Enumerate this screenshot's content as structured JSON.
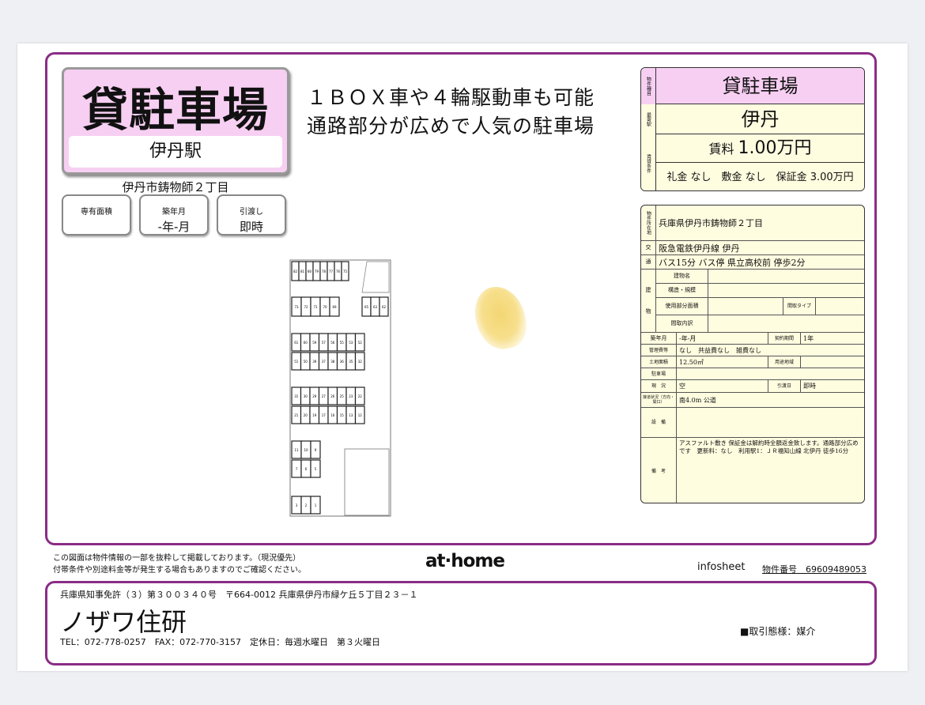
{
  "header": {
    "property_type": "貸駐車場",
    "station": "伊丹駅",
    "address_short": "伊丹市鋳物師２丁目",
    "catchcopy_line1": "１ＢＯＸ車や４輪駆動車も可能",
    "catchcopy_line2": "通路部分が広めで人気の駐車場"
  },
  "pills": [
    {
      "label": "専有面積",
      "value": ""
    },
    {
      "label": "築年月",
      "value": "-年-月"
    },
    {
      "label": "引渡し",
      "value": "即時"
    }
  ],
  "summary": {
    "side_type": "物件種目",
    "side_station": "最寄駅",
    "side_terms": "賃貸条件",
    "type": "貸駐車場",
    "station": "伊丹",
    "rent_label": "賃料",
    "rent_value": "1.00万円",
    "conditions": "礼金 なし　敷金 なし　保証金 3.00万円"
  },
  "details": {
    "side_location": "物件所在地",
    "location": "兵庫県伊丹市鋳物師２丁目",
    "side_transport_1": "交",
    "side_transport_2": "通",
    "transport1": "阪急電鉄伊丹線 伊丹",
    "transport2": "バス15分 バス停 県立高校前 停歩2分",
    "side_building_1": "建",
    "side_building_2": "物",
    "building_name_label": "建物名",
    "structure_label": "構造・規模",
    "floor_area_label": "使用部分面積",
    "layout_type_label": "間取タイプ",
    "layout_detail_label": "間取内訳",
    "built_label": "築年月",
    "built_value": "-年-月",
    "contract_label": "契約期間",
    "contract_value": "1年",
    "fee_label": "管理費等",
    "fee_value": "なし　共益費なし　雑費なし",
    "land_label": "土地面積",
    "land_value": "12.50㎡",
    "zone_label": "用途地域",
    "parking_label": "駐車場",
    "status_label": "現　況",
    "status_value": "空",
    "handover_label": "引渡日",
    "handover_value": "即時",
    "road_label": "接道状況（方向・間口）",
    "road_value": "南4.0m 公道",
    "equipment_label": "設　備",
    "remarks_label": "備　考",
    "remarks_value": "アスファルト敷き 保証金は解約時全額返金致します。通路部分広めです　更新料：なし　利用駅1：ＪＲ福知山線 北伊丹 徒歩16分"
  },
  "plan": {
    "row_a": [
      "82",
      "81",
      "80",
      "79",
      "78",
      "77",
      "76",
      "75"
    ],
    "row_b": [
      "73",
      "72",
      "71",
      "70",
      "69"
    ],
    "row_b_right": [
      "65",
      "63",
      "62"
    ],
    "row_c": [
      "61",
      "60",
      "59",
      "57",
      "56",
      "55",
      "53",
      "52"
    ],
    "row_d": [
      "51",
      "50",
      "39",
      "37",
      "38",
      "36",
      "35",
      "32"
    ],
    "row_e": [
      "31",
      "30",
      "29",
      "27",
      "26",
      "25",
      "23",
      "22"
    ],
    "row_f": [
      "21",
      "20",
      "19",
      "17",
      "16",
      "15",
      "13",
      "12"
    ],
    "row_g": [
      "11",
      "10",
      "9"
    ],
    "row_h": [
      "7",
      "6",
      "5"
    ],
    "row_i": [
      "3",
      "2",
      "1"
    ]
  },
  "footer": {
    "disclaimer_1": "この図面は物件情報の一部を抜粋して掲載しております。（現況優先）",
    "disclaimer_2": "付帯条件や別途料金等が発生する場合もありますのでご確認ください。",
    "athome_logo": "at·home",
    "infosheet": "infosheet",
    "property_number": "物件番号　69609489053",
    "license": "兵庫県知事免許（３）第３００３４０号　〒664-0012 兵庫県伊丹市緑ケ丘５丁目２３－１",
    "company": "ノザワ住研",
    "contact": "TEL：072-778-0257　FAX：072-770-3157　定休日：毎週水曜日　第３火曜日",
    "trade_type": "■取引態様：媒介"
  },
  "colors": {
    "frame": "#8a2c86",
    "title_bg": "#f7cff2",
    "detail_bg": "#fffde0"
  }
}
